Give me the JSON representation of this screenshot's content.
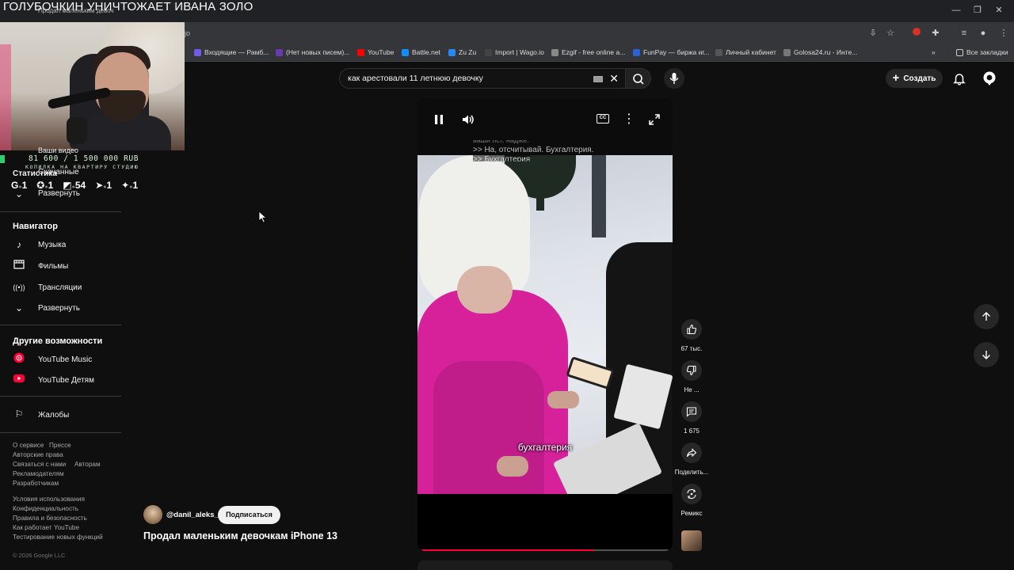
{
  "stream": {
    "overlay_title": "ГОЛУБОЧКИН УНИЧТОЖАЕТ ИВАНА ЗОЛО",
    "tab_hint": "Продал маленьким девоч",
    "donation_amount": "81 600 / 1 500 000 RUB",
    "donation_label": "КОПИЛКА НА КВАРТИРУ СТУДИЮ",
    "socials": [
      {
        "icon": "g-icon",
        "glyph": "G",
        "count": "1"
      },
      {
        "icon": "gear-icon",
        "glyph": "✪",
        "count": "1"
      },
      {
        "icon": "twitch-icon",
        "glyph": "◩",
        "count": "54"
      },
      {
        "icon": "arrow-icon",
        "glyph": "➤",
        "count": "1"
      },
      {
        "icon": "badge-icon",
        "glyph": "✦",
        "count": "1"
      }
    ]
  },
  "browser": {
    "url_fragment": "jo",
    "bookmarks": [
      {
        "label": "Входящие — Рамб...",
        "color": "#6c5ce7"
      },
      {
        "label": "(Нет новых писем)...",
        "color": "#6a3ab0"
      },
      {
        "label": "YouTube",
        "color": "#ff0000"
      },
      {
        "label": "Battle.net",
        "color": "#148eff"
      },
      {
        "label": "Zu Zu",
        "color": "#2787f5"
      },
      {
        "label": "Import | Wago.io",
        "color": "#222222"
      },
      {
        "label": "Ezgif - free online a...",
        "color": "#888888"
      },
      {
        "label": "FunPay — биржа иг...",
        "color": "#2a62d4"
      },
      {
        "label": "Личный кабинет",
        "color": "#555555"
      },
      {
        "label": "Golosa24.ru - Инте...",
        "color": "#777777"
      }
    ],
    "all_bookmarks": "Все закладки"
  },
  "sidebar": {
    "partial_items": [
      "Ваши видео",
      "Скачанные",
      "Развернуть"
    ],
    "stats_label": "Статистика",
    "navigator": {
      "heading": "Навигатор",
      "items": [
        {
          "icon": "music-note-icon",
          "glyph": "♪",
          "label": "Музыка"
        },
        {
          "icon": "film-icon",
          "glyph": "▤",
          "label": "Фильмы"
        },
        {
          "icon": "broadcast-icon",
          "glyph": "((•))",
          "label": "Трансляции"
        },
        {
          "icon": "chevron-down-icon",
          "glyph": "⌄",
          "label": "Развернуть"
        }
      ]
    },
    "more": {
      "heading": "Другие возможности",
      "items": [
        {
          "icon": "youtube-music-icon",
          "label": "YouTube Music"
        },
        {
          "icon": "youtube-kids-icon",
          "label": "YouTube Детям"
        }
      ]
    },
    "report": "Жалобы",
    "footer_1": [
      "О сервисе",
      "Прессе",
      "Авторские права",
      "Связаться с нами",
      "Авторам",
      "Рекламодателям",
      "Разработчикам"
    ],
    "footer_2": [
      "Условия использования",
      "Конфиденциальность",
      "Правила и безопасность",
      "Как работает YouTube",
      "Тестирование новых функций"
    ],
    "copyright": "© 2026 Google LLC"
  },
  "topbar": {
    "search_query": "как арестовали 11 летнюю девочку",
    "create_label": "Создать"
  },
  "player": {
    "subtitles": [
      "ваши пст. надже.",
      ">> На, отсчитывай. Бухгалтерия.",
      ">> Бухгалтерия"
    ],
    "caption": "бухгалтерия",
    "progress": 0.7,
    "cc": "CC"
  },
  "actions": {
    "likes": "67 тыс.",
    "dislike": "Не ...",
    "comments": "1 675",
    "share": "Поделить...",
    "remix": "Ремикс"
  },
  "channel": {
    "handle": "@danil_aleks_",
    "subscribe": "Подписаться",
    "video_title": "Продал маленьким девочкам iPhone 13"
  },
  "colors": {
    "accent": "#ff0033",
    "background": "#0f0f0f"
  }
}
